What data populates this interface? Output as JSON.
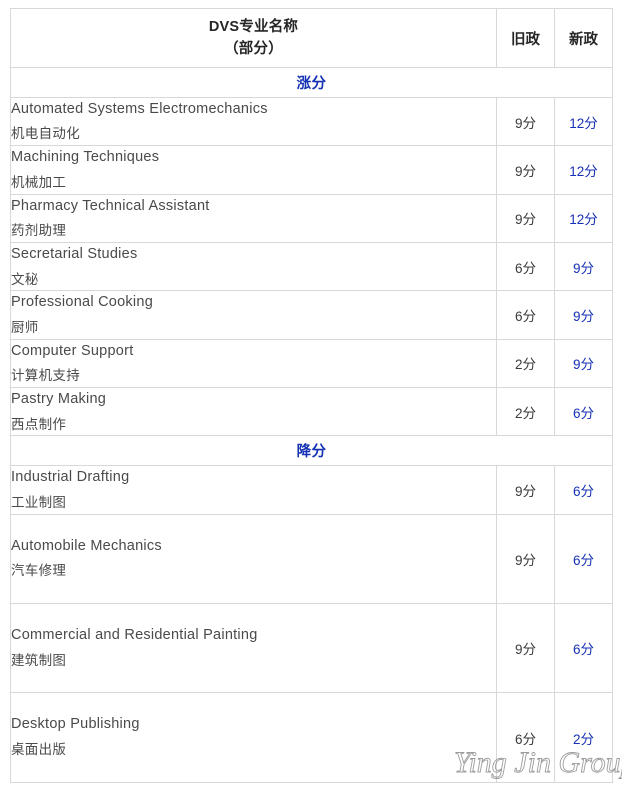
{
  "table": {
    "header": {
      "name_line1": "DVS专业名称",
      "name_line2": "（部分）",
      "old_policy": "旧政",
      "new_policy": "新政"
    },
    "sections": [
      {
        "label": "涨分",
        "rows": [
          {
            "en": "Automated Systems Electromechanics",
            "zh": "机电自动化",
            "old": "9分",
            "new": "12分"
          },
          {
            "en": "Machining Techniques",
            "zh": "机械加工",
            "old": "9分",
            "new": "12分"
          },
          {
            "en": "Pharmacy Technical Assistant",
            "zh": "药剂助理",
            "old": "9分",
            "new": "12分"
          },
          {
            "en": "Secretarial Studies",
            "zh": "文秘",
            "old": "6分",
            "new": "9分"
          },
          {
            "en": "Professional Cooking",
            "zh": "厨师",
            "old": "6分",
            "new": "9分"
          },
          {
            "en": "Computer Support",
            "zh": "计算机支持",
            "old": "2分",
            "new": "9分"
          },
          {
            "en": "Pastry Making",
            "zh": "西点制作",
            "old": "2分",
            "new": "6分"
          }
        ]
      },
      {
        "label": "降分",
        "rows": [
          {
            "en": "Industrial Drafting",
            "zh": "工业制图",
            "old": "9分",
            "new": "6分"
          },
          {
            "en": "Automobile Mechanics",
            "zh": "汽车修理",
            "old": "9分",
            "new": "6分"
          },
          {
            "en": "Commercial and Residential Painting",
            "zh": "建筑制图",
            "old": "9分",
            "new": "6分"
          },
          {
            "en": "Desktop Publishing",
            "zh": "桌面出版",
            "old": "6分",
            "new": "2分"
          }
        ]
      }
    ]
  },
  "watermark": {
    "text": "Ying Jin Group"
  },
  "colors": {
    "new_score": "#1632b4",
    "old_score": "#3a3a3a",
    "section_header": "#1632b4",
    "body_text": "#4a4a4a",
    "border": "#d8d8d8"
  }
}
